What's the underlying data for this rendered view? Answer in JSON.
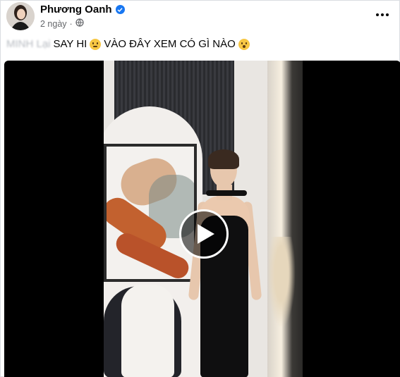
{
  "post": {
    "author": "Phương Oanh",
    "time": "2 ngày",
    "privacy_icon": "globe-icon",
    "more_icon": "more-options-icon"
  },
  "caption": {
    "blurred": "MINH Lại",
    "part1": "SAY HI",
    "emoji1": "grimacing-face",
    "part2": "VÀO ĐÂY XEM CÓ GÌ NÀO",
    "emoji2": "hushed-face"
  },
  "video": {
    "play_icon": "play-icon"
  },
  "colors": {
    "verified": "#1877f2",
    "meta_text": "#65676b",
    "video_bg": "#000000"
  }
}
